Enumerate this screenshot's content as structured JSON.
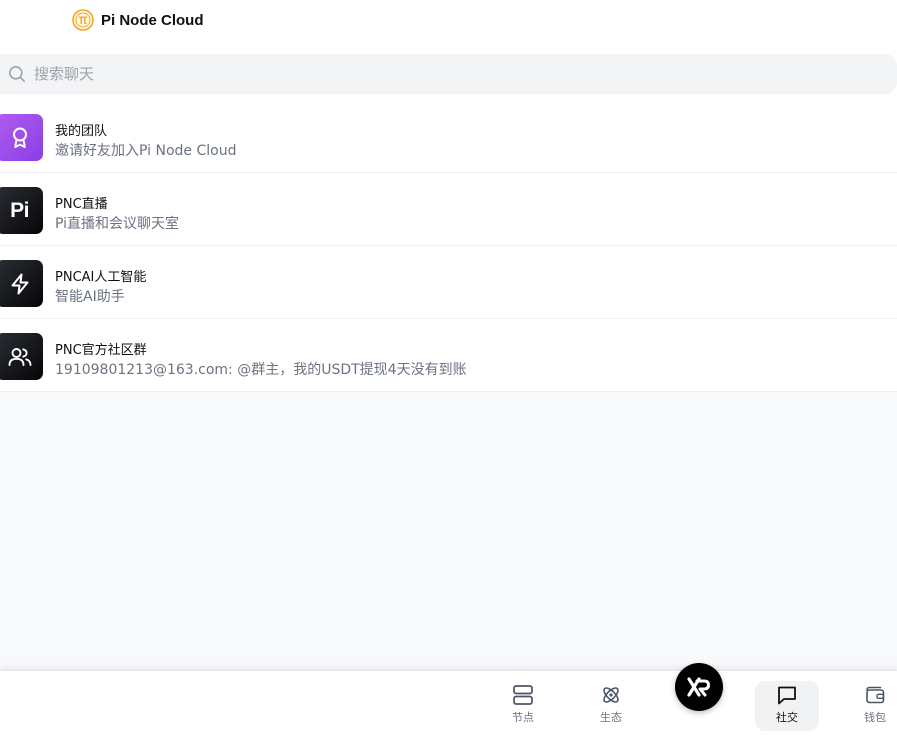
{
  "header": {
    "brand_name": "Pi Node Cloud",
    "logo_icon": "pi-coin-logo"
  },
  "search": {
    "placeholder": "搜索聊天",
    "value": ""
  },
  "chats": [
    {
      "title": "我的团队",
      "subtitle": "邀请好友加入Pi Node Cloud",
      "icon": "award-icon",
      "color": "#9b4ff0"
    },
    {
      "title": "PNC直播",
      "subtitle": "Pi直播和会议聊天室",
      "icon": "pi-logo",
      "avatar_text": "Pi",
      "color": "#0a0b0e"
    },
    {
      "title": "PNCAI人工智能",
      "subtitle": "智能AI助手",
      "icon": "lightning-icon",
      "color": "#0a0b0e"
    },
    {
      "title": "PNC官方社区群",
      "subtitle": "19109801213@163.com: @群主，我的USDT提现4天没有到账",
      "icon": "users-icon",
      "color": "#0a0b0e"
    }
  ],
  "bottom_nav": {
    "items": [
      {
        "label": "节点",
        "icon": "server-icon"
      },
      {
        "label": "生态",
        "icon": "atom-icon"
      },
      {
        "label": "",
        "icon": "xp-logo-icon"
      },
      {
        "label": "社交",
        "icon": "chat-bubble-icon",
        "active": true
      },
      {
        "label": "钱包",
        "icon": "wallet-icon"
      }
    ]
  }
}
